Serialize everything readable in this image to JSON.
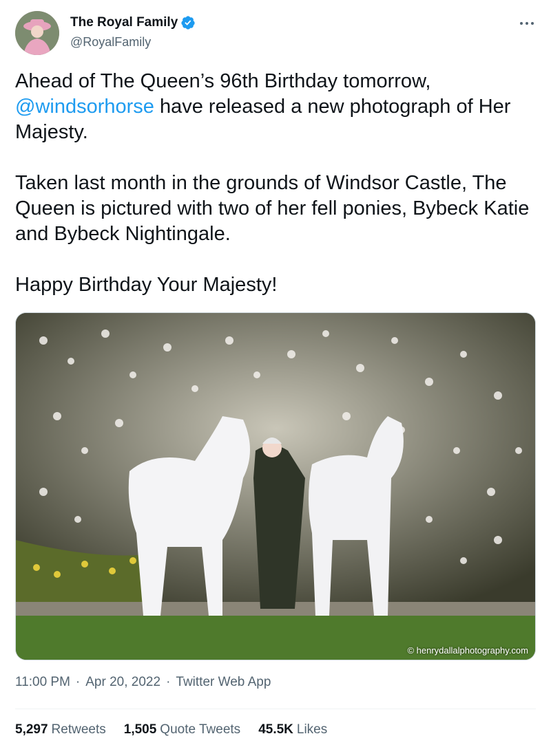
{
  "author": {
    "display_name": "The Royal Family",
    "handle": "@RoyalFamily",
    "verified": true
  },
  "tweet": {
    "text_1": "Ahead of The Queen’s 96th Birthday tomorrow,\n",
    "mention": "@windsorhorse",
    "text_2": " have released a new photograph of Her Majesty.\n\nTaken last month in the grounds of Windsor Castle, The Queen is pictured with two of her fell ponies, Bybeck Katie and Bybeck Nightingale.\n\nHappy Birthday Your Majesty!"
  },
  "photo": {
    "credit": "© henrydallalphotography.com"
  },
  "meta": {
    "time": "11:00 PM",
    "date": "Apr 20, 2022",
    "source": "Twitter Web App",
    "separator": "·"
  },
  "stats": [
    {
      "value": "5,297",
      "label": "Retweets"
    },
    {
      "value": "1,505",
      "label": "Quote Tweets"
    },
    {
      "value": "45.5K",
      "label": "Likes"
    }
  ],
  "colors": {
    "accent": "#1d9bf0",
    "text": "#0f1419",
    "secondary": "#536471"
  }
}
